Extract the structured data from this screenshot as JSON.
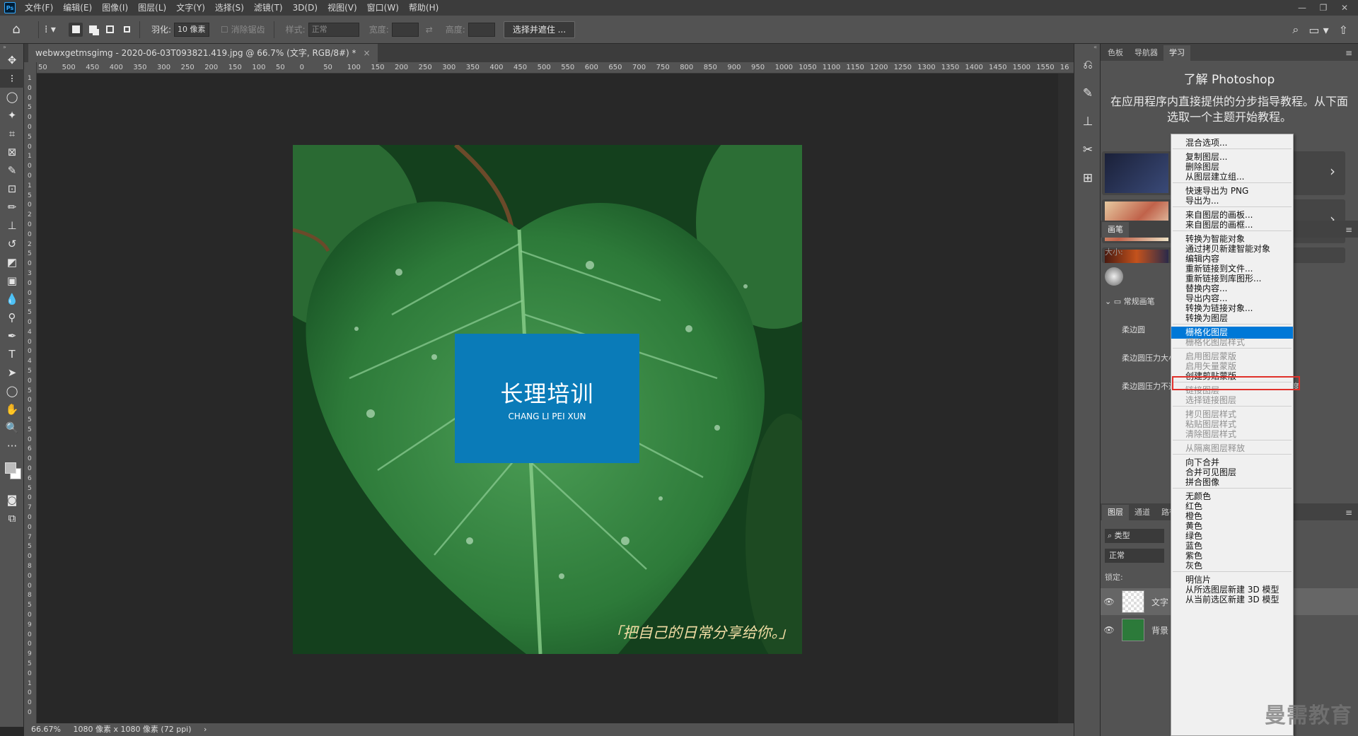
{
  "menubar": {
    "items": [
      "文件(F)",
      "编辑(E)",
      "图像(I)",
      "图层(L)",
      "文字(Y)",
      "选择(S)",
      "滤镜(T)",
      "3D(D)",
      "视图(V)",
      "窗口(W)",
      "帮助(H)"
    ]
  },
  "optbar": {
    "feather_label": "羽化:",
    "feather_value": "10 像素",
    "antialias_label": "消除锯齿",
    "style_label": "样式:",
    "style_value": "正常",
    "width_label": "宽度:",
    "height_label": "高度:",
    "select_mask_button": "选择并遮住 ..."
  },
  "document": {
    "tab_title": "webwxgetmsgimg - 2020-06-03T093821.419.jpg @ 66.7% (文字, RGB/8#) *",
    "ruler_h_labels": [
      "50",
      "500",
      "450",
      "400",
      "350",
      "300",
      "250",
      "200",
      "150",
      "100",
      "50",
      "0",
      "50",
      "100",
      "150",
      "200",
      "250",
      "300",
      "350",
      "400",
      "450",
      "500",
      "550",
      "600",
      "650",
      "700",
      "750",
      "800",
      "850",
      "900",
      "950",
      "1000",
      "1050",
      "1100",
      "1150",
      "1200",
      "1250",
      "1300",
      "1350",
      "1400",
      "1450",
      "1500",
      "1550",
      "16"
    ],
    "ruler_v_labels": [
      "1",
      "0",
      "0",
      "5",
      "0",
      "0",
      "5",
      "0",
      "1",
      "0",
      "0",
      "1",
      "5",
      "0",
      "2",
      "0",
      "0",
      "2",
      "5",
      "0",
      "3",
      "0",
      "0",
      "3",
      "5",
      "0",
      "4",
      "0",
      "0",
      "4",
      "5",
      "0",
      "5",
      "0",
      "0",
      "5",
      "5",
      "0",
      "6",
      "0",
      "0",
      "6",
      "5",
      "0",
      "7",
      "0",
      "0",
      "7",
      "5",
      "0",
      "8",
      "0",
      "0",
      "8",
      "5",
      "0",
      "9",
      "0",
      "0",
      "9",
      "5",
      "0",
      "1",
      "0",
      "0",
      "0"
    ],
    "zoom": "66.67%",
    "doc_size": "1080 像素 x 1080 像素 (72 ppi)"
  },
  "artwork": {
    "logo_cn": "长理培训",
    "logo_en": "CHANG LI PEI XUN",
    "caption": "「把自己的日常分享给你。」"
  },
  "learn_panel": {
    "tabs": [
      "色板",
      "导航器",
      "学习"
    ],
    "title": "了解 Photoshop",
    "desc": "在应用程序内直接提供的分步指导教程。从下面选取一个主题开始教程。"
  },
  "brush_panel": {
    "tab": "画笔",
    "size_label": "大小:",
    "group": "常规画笔",
    "brushes": [
      "柔边圆",
      "柔边圆压力大小",
      "柔边圆压力不透"
    ],
    "partial_label": "度"
  },
  "layers_panel": {
    "tabs": [
      "图层",
      "通道",
      "路径"
    ],
    "filter": "类型",
    "blend": "正常",
    "lock_label": "锁定:",
    "layers": [
      {
        "name": "文字"
      },
      {
        "name": "背景"
      }
    ]
  },
  "context_menu": {
    "groups": [
      [
        {
          "label": "混合选项...",
          "enabled": true
        }
      ],
      [
        {
          "label": "复制图层...",
          "enabled": true
        },
        {
          "label": "删除图层",
          "enabled": true
        },
        {
          "label": "从图层建立组...",
          "enabled": true
        }
      ],
      [
        {
          "label": "快速导出为 PNG",
          "enabled": true
        },
        {
          "label": "导出为...",
          "enabled": true
        }
      ],
      [
        {
          "label": "来自图层的画板...",
          "enabled": true
        },
        {
          "label": "来自图层的画框...",
          "enabled": true
        }
      ],
      [
        {
          "label": "转换为智能对象",
          "enabled": true
        },
        {
          "label": "通过拷贝新建智能对象",
          "enabled": true
        },
        {
          "label": "编辑内容",
          "enabled": true
        },
        {
          "label": "重新链接到文件...",
          "enabled": true
        },
        {
          "label": "重新链接到库图形...",
          "enabled": true
        },
        {
          "label": "替换内容...",
          "enabled": true
        },
        {
          "label": "导出内容...",
          "enabled": true
        },
        {
          "label": "转换为链接对象...",
          "enabled": true
        },
        {
          "label": "转换为图层",
          "enabled": true
        }
      ],
      [
        {
          "label": "栅格化图层",
          "enabled": true,
          "highlighted": true
        },
        {
          "label": "栅格化图层样式",
          "enabled": false
        }
      ],
      [
        {
          "label": "启用图层蒙版",
          "enabled": false
        },
        {
          "label": "启用矢量蒙版",
          "enabled": false
        },
        {
          "label": "创建剪贴蒙版",
          "enabled": true
        }
      ],
      [
        {
          "label": "链接图层",
          "enabled": false
        },
        {
          "label": "选择链接图层",
          "enabled": false
        }
      ],
      [
        {
          "label": "拷贝图层样式",
          "enabled": false
        },
        {
          "label": "粘贴图层样式",
          "enabled": false
        },
        {
          "label": "清除图层样式",
          "enabled": false
        }
      ],
      [
        {
          "label": "从隔离图层释放",
          "enabled": false
        }
      ],
      [
        {
          "label": "向下合并",
          "enabled": true
        },
        {
          "label": "合并可见图层",
          "enabled": true
        },
        {
          "label": "拼合图像",
          "enabled": true
        }
      ],
      [
        {
          "label": "无颜色",
          "enabled": true
        },
        {
          "label": "红色",
          "enabled": true
        },
        {
          "label": "橙色",
          "enabled": true
        },
        {
          "label": "黄色",
          "enabled": true
        },
        {
          "label": "绿色",
          "enabled": true
        },
        {
          "label": "蓝色",
          "enabled": true
        },
        {
          "label": "紫色",
          "enabled": true
        },
        {
          "label": "灰色",
          "enabled": true
        }
      ],
      [
        {
          "label": "明信片",
          "enabled": true
        },
        {
          "label": "从所选图层新建 3D 模型",
          "enabled": true
        },
        {
          "label": "从当前选区新建 3D 模型",
          "enabled": true
        }
      ]
    ]
  },
  "watermark": "曼需教育",
  "colors": {
    "highlight": "#0078d7",
    "logo_blue": "#0a7bb8",
    "caption": "#f1dca4"
  }
}
